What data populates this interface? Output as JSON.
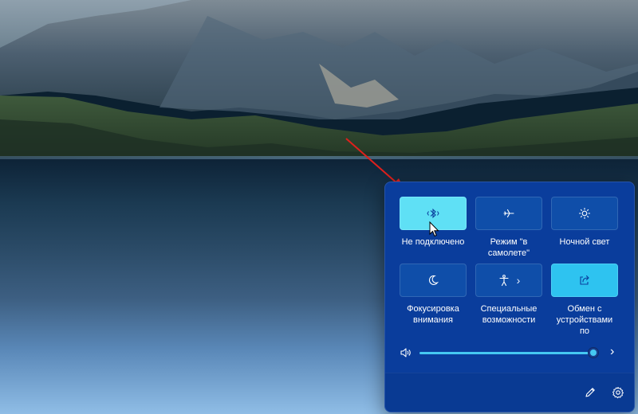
{
  "quick_settings": {
    "tiles": [
      {
        "label": "Не подключено",
        "icon": "bluetooth-disconnected-icon",
        "state": "active"
      },
      {
        "label": "Режим \"в самолете\"",
        "icon": "airplane-icon",
        "state": "off"
      },
      {
        "label": "Ночной свет",
        "icon": "brightness-icon",
        "state": "off"
      },
      {
        "label": "Фокусировка внимания",
        "icon": "moon-icon",
        "state": "off"
      },
      {
        "label": "Специальные возможности",
        "icon": "accessibility-icon",
        "state": "off",
        "has_chevron": true
      },
      {
        "label": "Обмен с устройствами по",
        "icon": "share-icon",
        "state": "on"
      }
    ],
    "volume": {
      "icon": "speaker-icon",
      "level": 0.99,
      "chevron": "›"
    },
    "footer": {
      "edit_icon": "pencil-icon",
      "settings_icon": "gear-icon"
    }
  },
  "colors": {
    "panel_bg": "#0a3d9c",
    "tile_bg": "#0f4ea9",
    "tile_active": "#5fe0f5",
    "tile_on": "#2ec3f0",
    "accent": "#45c8f2",
    "arrow": "#e0201c"
  }
}
